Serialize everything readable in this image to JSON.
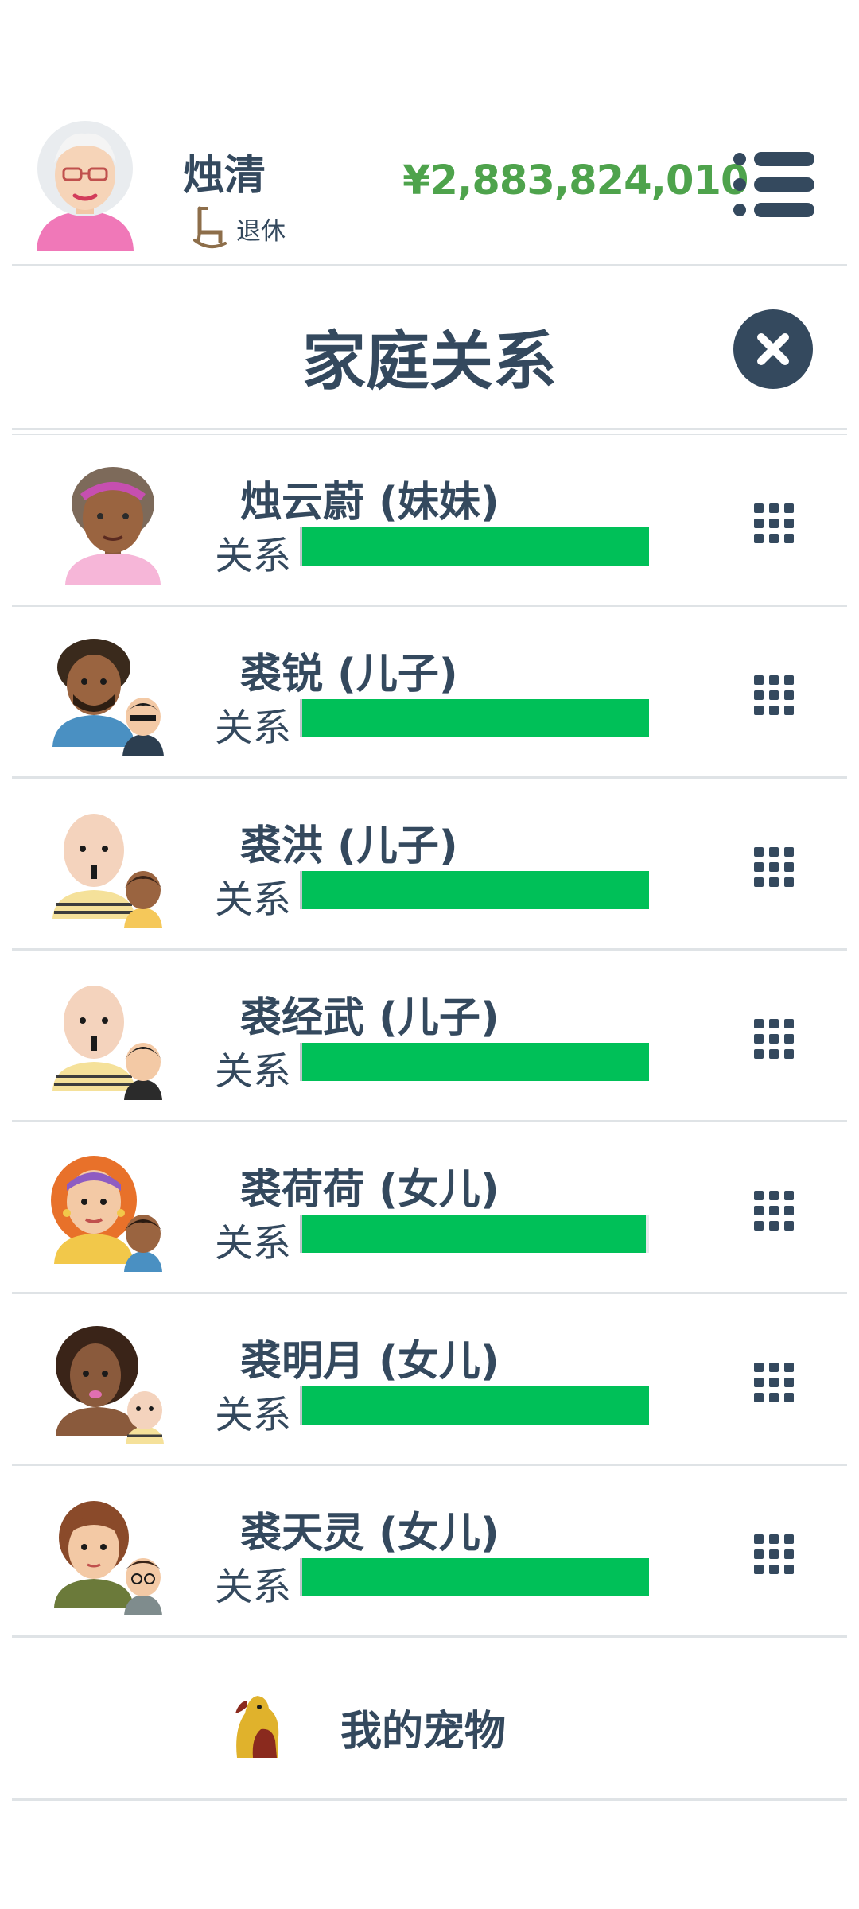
{
  "header": {
    "avatar": "elderly-woman-avatar",
    "name": "烛清",
    "job_icon": "rocking-chair-icon",
    "job": "退休",
    "money": "¥2,883,824,010",
    "menu_icon": "menu-list-icon"
  },
  "title": "家庭关系",
  "close_icon": "close-icon",
  "relation_label": "关系",
  "members": [
    {
      "name": "烛云蔚 (妹妹)",
      "avatar": "woman-purple-headband-avatar",
      "relationship": 1.0
    },
    {
      "name": "裘锐 (儿子)",
      "avatar": "man-with-child-avatar",
      "relationship": 1.0
    },
    {
      "name": "裘洪 (儿子)",
      "avatar": "bald-man-with-child-avatar",
      "relationship": 1.0
    },
    {
      "name": "裘经武 (儿子)",
      "avatar": "bald-man-with-child-avatar",
      "relationship": 1.0
    },
    {
      "name": "裘荷荷 (女儿)",
      "avatar": "woman-with-child-avatar",
      "relationship": 0.99
    },
    {
      "name": "裘明月 (女儿)",
      "avatar": "woman-with-baby-avatar",
      "relationship": 1.0
    },
    {
      "name": "裘天灵 (女儿)",
      "avatar": "woman-with-boy-avatar",
      "relationship": 1.0
    }
  ],
  "grid_icon": "grid-dots-icon",
  "pets": {
    "label": "我的宠物",
    "icon": "dog-icon"
  },
  "colors": {
    "text": "#34495e",
    "money": "#4ea34c",
    "bar": "#00c058",
    "divider": "#dfe3e6"
  }
}
